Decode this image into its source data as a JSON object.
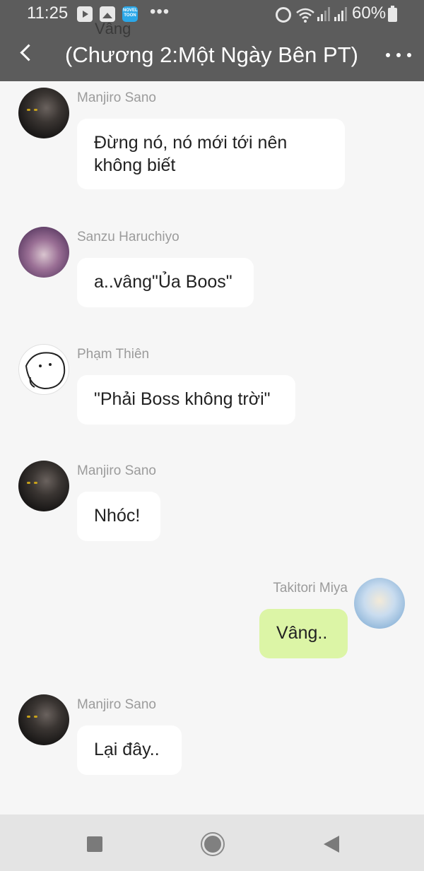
{
  "status_bar": {
    "time": "11:25",
    "ellipsis": "•••",
    "battery": "60%",
    "novel_badge": "NOVEL TOON"
  },
  "header": {
    "ghost_text": "Vâng",
    "title": "(Chương 2:Một Ngày Bên PT)"
  },
  "messages": [
    {
      "sender": "Manjiro Sano",
      "text": "Đừng nó, nó mới tới nên không biết",
      "side": "left",
      "avatar": "mikey-avatar"
    },
    {
      "sender": "Sanzu Haruchiyo",
      "text": "a..vâng\"Ủa Boos\"",
      "side": "left",
      "avatar": "sanzu-avatar"
    },
    {
      "sender": "Phạm Thiên",
      "text": "\"Phải Boss không trời\"",
      "side": "left",
      "avatar": "pham-thien-avatar"
    },
    {
      "sender": "Manjiro Sano",
      "text": "Nhóc!",
      "side": "left",
      "avatar": "mikey-avatar"
    },
    {
      "sender": "Takitori Miya",
      "text": "Vâng..",
      "side": "right",
      "avatar": "miya-avatar"
    },
    {
      "sender": "Manjiro Sano",
      "text": "Lại đây..",
      "side": "left",
      "avatar": "mikey-avatar"
    }
  ],
  "colors": {
    "header_bg": "#5c5c5c",
    "page_bg": "#f6f6f6",
    "incoming_bubble": "#ffffff",
    "outgoing_bubble": "#dcf5a6",
    "sender_text": "#9b9b9b"
  }
}
